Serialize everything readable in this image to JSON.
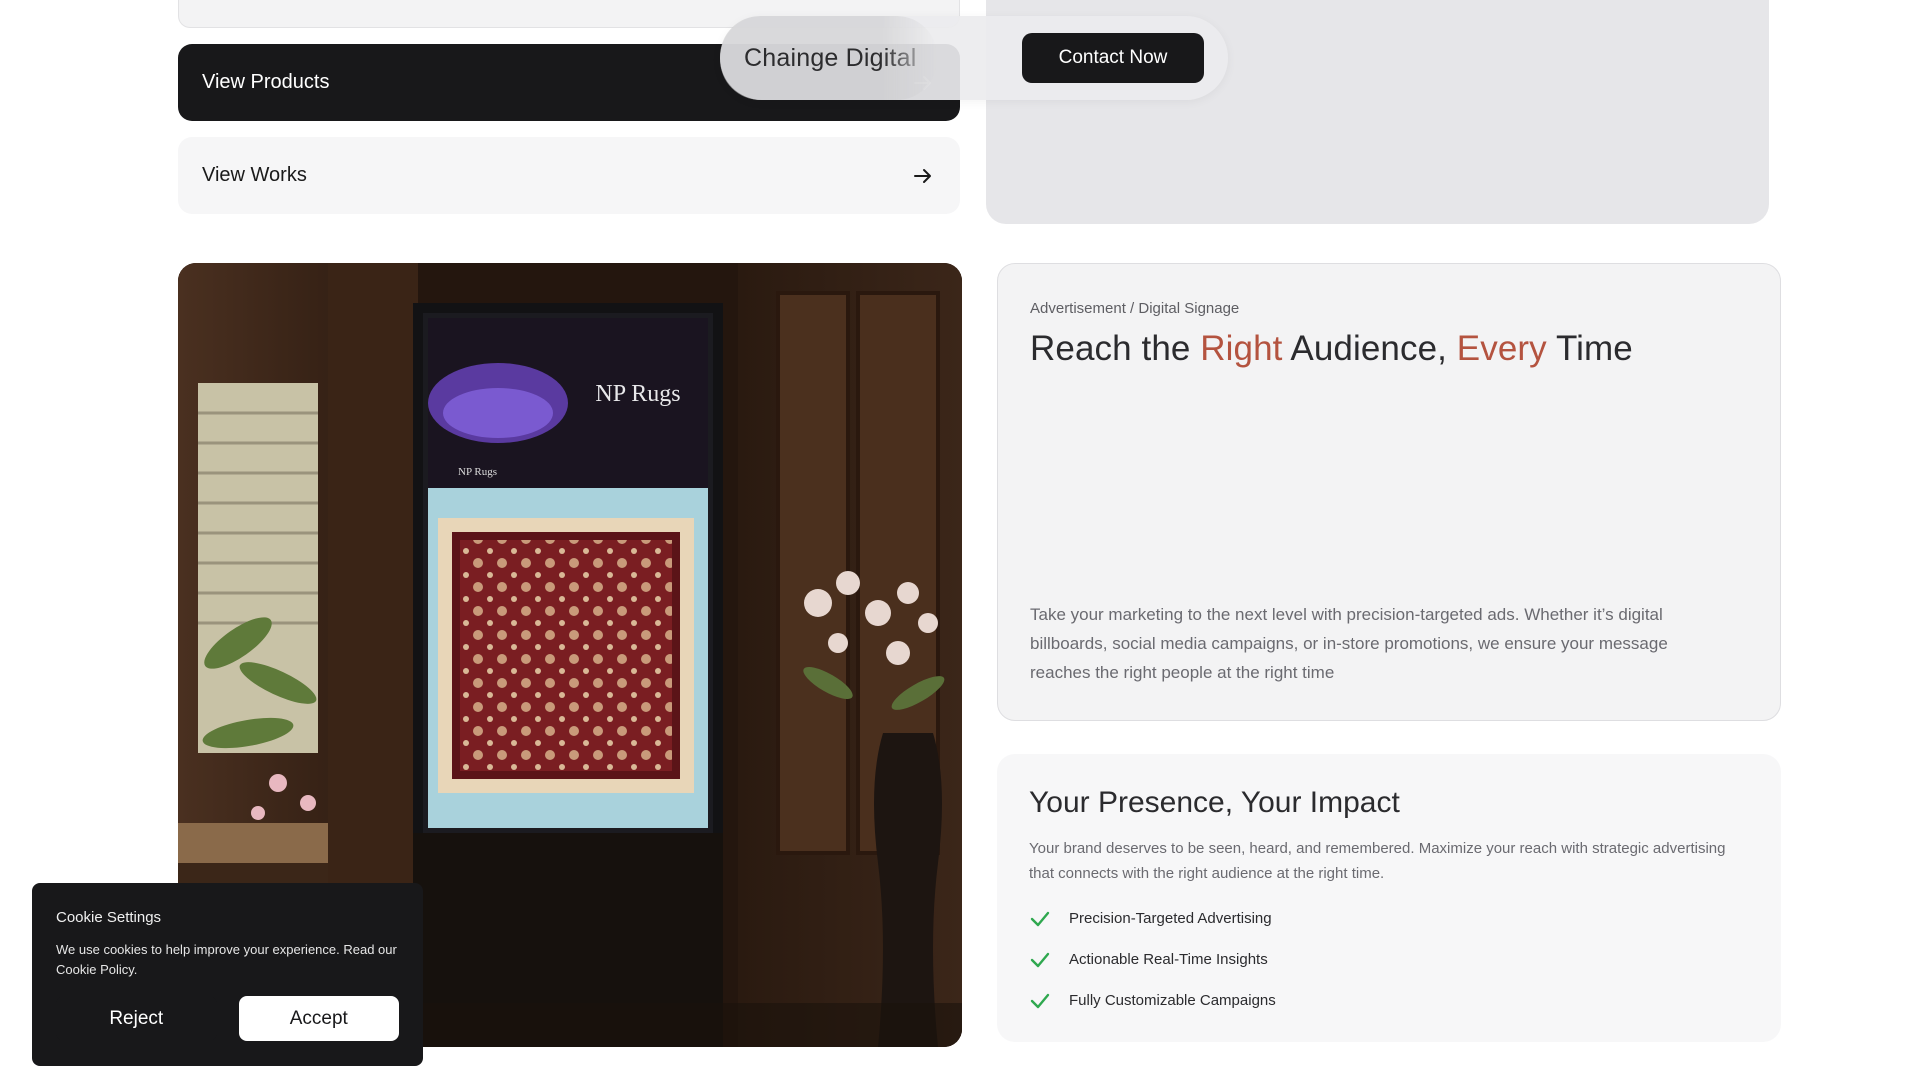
{
  "header": {
    "brand": "Chainge Digital",
    "contact_label": "Contact Now"
  },
  "nav": {
    "view_products": "View Products",
    "view_works": "View Works"
  },
  "media": {
    "sign_brand": "NP Rugs",
    "sign_brand_small": "NP Rugs"
  },
  "ad": {
    "eyebrow": "Advertisement / Digital Signage",
    "title_1": "Reach the ",
    "title_hl_1": "Right",
    "title_2": " Audience, ",
    "title_hl_2": "Every",
    "title_3": " Time",
    "body": "Take your marketing to the next level with precision-targeted ads. Whether it’s digital billboards, social media campaigns, or in-store promotions, we ensure your message reaches the right people at the right time",
    "accent_color": "#b4533f"
  },
  "presence": {
    "title": "Your Presence, Your Impact",
    "body": "Your brand deserves to be seen, heard, and remembered. Maximize your reach with strategic advertising that connects with the right audience at the right time.",
    "features": [
      "Precision-Targeted Advertising",
      "Actionable Real-Time Insights",
      "Fully Customizable Campaigns"
    ],
    "check_color": "#2fa84f"
  },
  "cookie": {
    "title": "Cookie Settings",
    "text": "We use cookies to help improve your experience. Read our Cookie Policy.",
    "reject_label": "Reject",
    "accept_label": "Accept"
  }
}
